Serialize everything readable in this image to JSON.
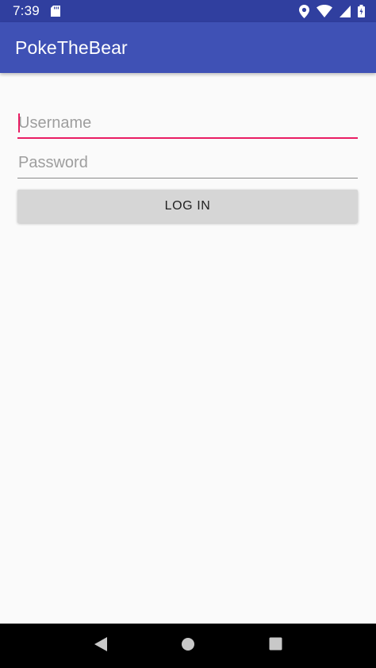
{
  "status_bar": {
    "time": "7:39",
    "icons": [
      "sd-card-icon",
      "location-icon",
      "wifi-icon",
      "battery-icon"
    ]
  },
  "app_bar": {
    "title": "PokeTheBear",
    "color": "#3f51b5",
    "status_color": "#303f9f"
  },
  "form": {
    "username": {
      "placeholder": "Username",
      "value": "",
      "focused": true
    },
    "password": {
      "placeholder": "Password",
      "value": ""
    },
    "login_label": "LOG IN",
    "accent_color": "#e91e63"
  },
  "nav_bar": {
    "icons": [
      "back-icon",
      "home-icon",
      "recents-icon"
    ]
  }
}
